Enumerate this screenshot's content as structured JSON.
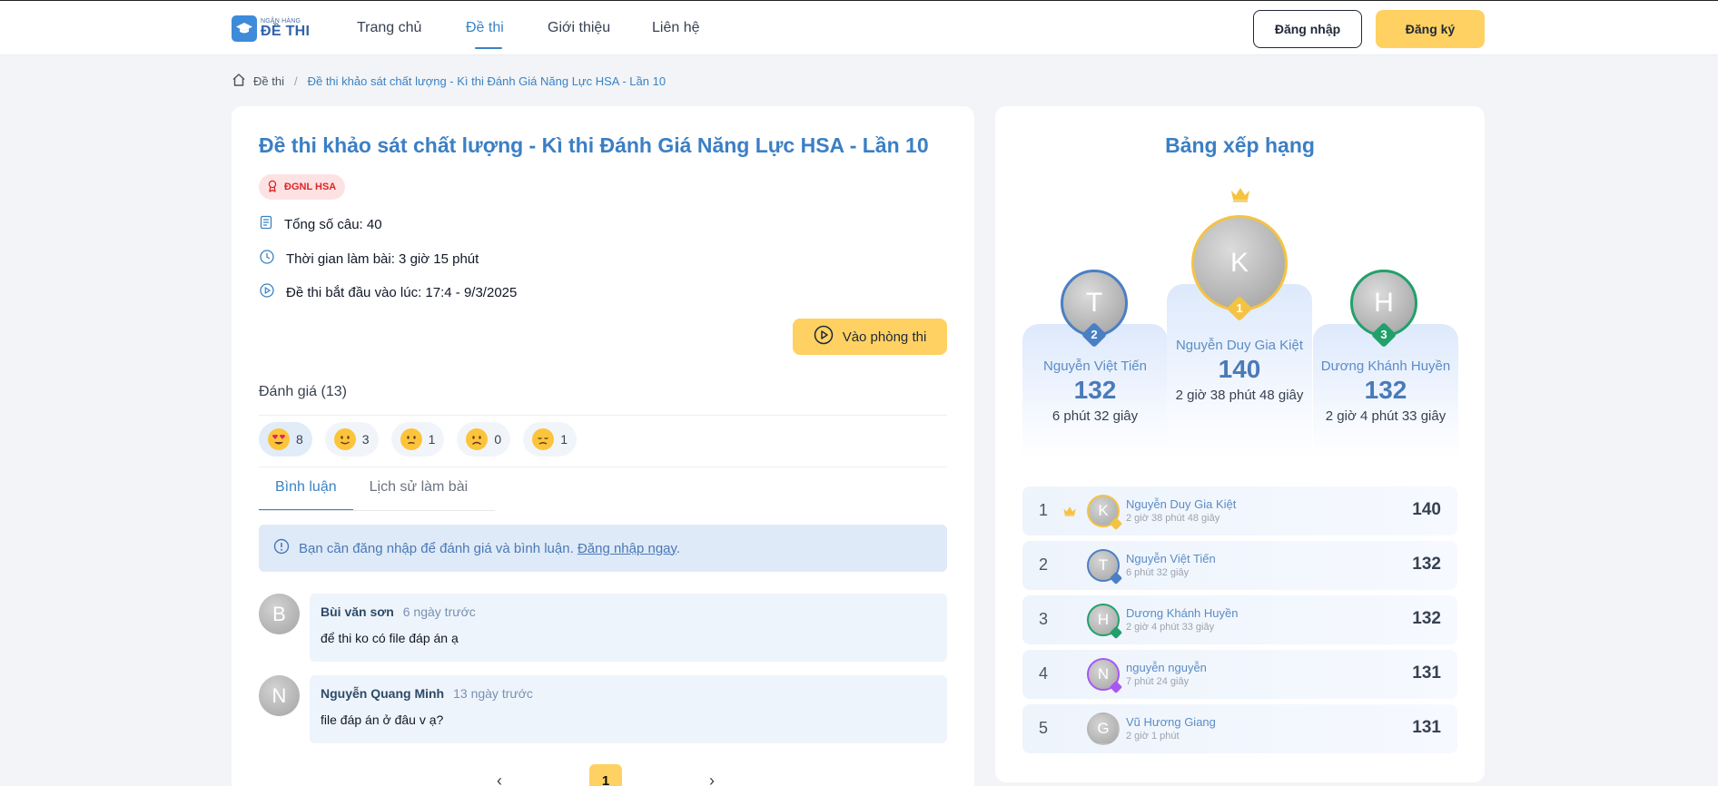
{
  "header": {
    "logo_small": "NGÂN HÀNG",
    "logo_big": "ĐỀ THI",
    "nav": [
      {
        "label": "Trang chủ"
      },
      {
        "label": "Đề thi"
      },
      {
        "label": "Giới thiệu"
      },
      {
        "label": "Liên hệ"
      }
    ],
    "login_label": "Đăng nhập",
    "register_label": "Đăng ký"
  },
  "breadcrumb": {
    "root": "Đề thi",
    "separator": "/",
    "current": "Đề thi khảo sát chất lượng - Kì thi Đánh Giá Năng Lực HSA - Lần 10"
  },
  "exam": {
    "title": "Đề thi khảo sát chất lượng - Kì thi Đánh Giá Năng Lực HSA - Lần 10",
    "tag": "ĐGNL HSA",
    "total_questions": "Tổng số câu: 40",
    "duration": "Thời gian làm bài: 3 giờ 15 phút",
    "start": "Đề thi bắt đầu vào lúc: 17:4 - 9/3/2025",
    "enter_button": "Vào phòng thi"
  },
  "rating": {
    "title": "Đánh giá (13)",
    "reactions": [
      {
        "icon": "heart-eyes-emoji",
        "count": "8"
      },
      {
        "icon": "smile-emoji",
        "count": "3"
      },
      {
        "icon": "slightly-frowning-emoji",
        "count": "1"
      },
      {
        "icon": "frowning-emoji",
        "count": "0"
      },
      {
        "icon": "disappointed-emoji",
        "count": "1"
      }
    ]
  },
  "tabs": [
    {
      "label": "Bình luận"
    },
    {
      "label": "Lịch sử làm bài"
    }
  ],
  "alert": {
    "text": "Bạn cần đăng nhập để đánh giá và bình luận.",
    "link": "Đăng nhập ngay",
    "suffix": "."
  },
  "comments": [
    {
      "initial": "B",
      "name": "Bùi văn sơn",
      "time": "6 ngày trước",
      "text": "để thi ko có file đáp án ạ"
    },
    {
      "initial": "N",
      "name": "Nguyễn Quang Minh",
      "time": "13 ngày trước",
      "text": "file đáp án ở đâu v ạ?"
    }
  ],
  "pagination": {
    "prev": "‹",
    "current": "1",
    "next": "›"
  },
  "ranking": {
    "title": "Bảng xếp hạng",
    "podium": [
      {
        "rank": "2",
        "initial": "T",
        "name": "Nguyễn Việt Tiến",
        "score": "132",
        "time": "6 phút 32 giây",
        "color": "#4a7fc4"
      },
      {
        "rank": "1",
        "initial": "K",
        "name": "Nguyễn Duy Gia Kiệt",
        "score": "140",
        "time": "2 giờ 38 phút 48 giây",
        "color": "#f5c342"
      },
      {
        "rank": "3",
        "initial": "H",
        "name": "Dương Khánh Huyền",
        "score": "132",
        "time": "2 giờ 4 phút 33 giây",
        "color": "#22a06b"
      }
    ],
    "list": [
      {
        "rank": "1",
        "initial": "K",
        "name": "Nguyễn Duy Gia Kiệt",
        "time": "2 giờ 38 phút 48 giây",
        "score": "140",
        "color": "#f5c342"
      },
      {
        "rank": "2",
        "initial": "T",
        "name": "Nguyễn Việt Tiến",
        "time": "6 phút 32 giây",
        "score": "132",
        "color": "#4a7fc4"
      },
      {
        "rank": "3",
        "initial": "H",
        "name": "Dương Khánh Huyền",
        "time": "2 giờ 4 phút 33 giây",
        "score": "132",
        "color": "#22a06b"
      },
      {
        "rank": "4",
        "initial": "N",
        "name": "nguyễn nguyễn",
        "time": "7 phút 24 giây",
        "score": "131",
        "color": "#a855f7"
      },
      {
        "rank": "5",
        "initial": "G",
        "name": "Vũ Hương Giang",
        "time": "2 giờ 1 phút",
        "score": "131",
        "color": ""
      }
    ]
  }
}
